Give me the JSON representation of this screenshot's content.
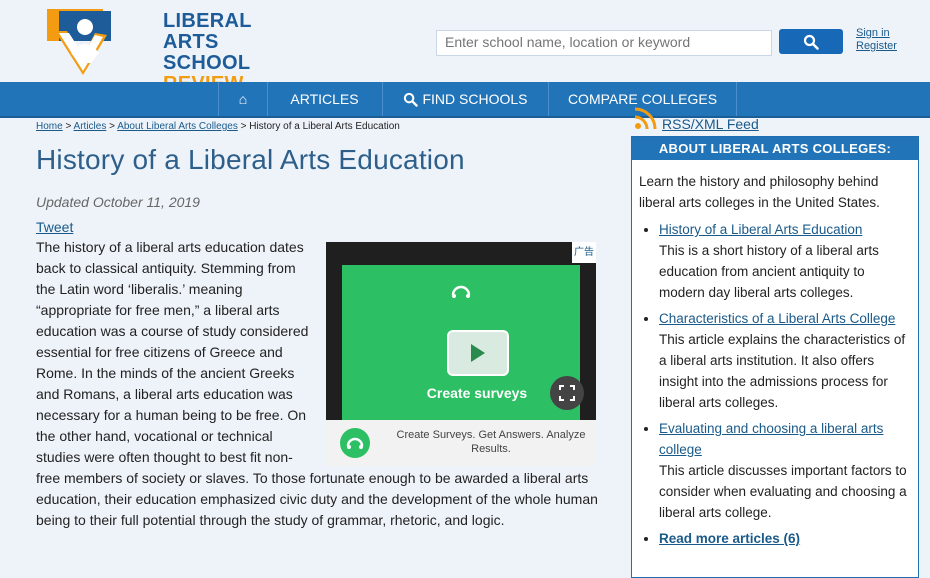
{
  "logo": {
    "line1": "LIBERAL ARTS",
    "line2": "SCHOOL",
    "line3": "REVIEW",
    "colors": {
      "blue": "#1e5c99",
      "orange": "#f39c12"
    }
  },
  "search": {
    "placeholder": "Enter school name, location or keyword",
    "button_icon": "search-icon"
  },
  "auth": {
    "sign_in": "Sign in",
    "register": "Register"
  },
  "nav": {
    "home_icon": "⌂",
    "articles": "ARTICLES",
    "find_schools": "FIND SCHOOLS",
    "compare_colleges": "COMPARE COLLEGES"
  },
  "breadcrumb": {
    "home": "Home",
    "articles": "Articles",
    "about": "About Liberal Arts Colleges",
    "current": "History of a Liberal Arts Education",
    "sep": ">"
  },
  "rss": {
    "label": "RSS/XML Feed"
  },
  "main": {
    "title": "History of a Liberal Arts Education",
    "updated": "Updated October 11, 2019",
    "tweet": "Tweet",
    "body": "The history of a liberal arts education dates back to classical antiquity. Stemming from the Latin word ‘liberalis.’ meaning “appropriate for free men,” a liberal arts education was a course of study considered essential for free citizens of Greece and Rome.   In the minds of the ancient Greeks and Romans, a liberal arts education was necessary for a human being to be free. On the other hand, vocational or technical studies were often thought to best fit non-free members of society or slaves. To those fortunate enough to be awarded a liberal arts education, their education emphasized civic duty and the development of the whole human being to their full potential through the study of grammar, rhetoric, and logic."
  },
  "ad": {
    "badge": "广告",
    "caption": "Create surveys",
    "bottom_text": "Create Surveys. Get Answers. Analyze Results.",
    "colors": {
      "green": "#2cbf64"
    }
  },
  "sidebar": {
    "heading": "ABOUT LIBERAL ARTS COLLEGES:",
    "intro": "Learn the history and philosophy behind liberal arts colleges in the United States.",
    "items": [
      {
        "title": "History of a Liberal Arts Education",
        "desc": "This is a short history of a liberal arts education from ancient antiquity to modern day liberal arts colleges."
      },
      {
        "title": "Characteristics of a Liberal Arts College",
        "desc": "This article explains the characteristics of a liberal arts institution. It also offers insight into the admissions process for liberal arts colleges."
      },
      {
        "title": "Evaluating and choosing a liberal arts college",
        "desc": "This article discusses important factors to consider when evaluating and choosing a liberal arts college."
      }
    ],
    "read_more": "Read more articles (6)"
  }
}
